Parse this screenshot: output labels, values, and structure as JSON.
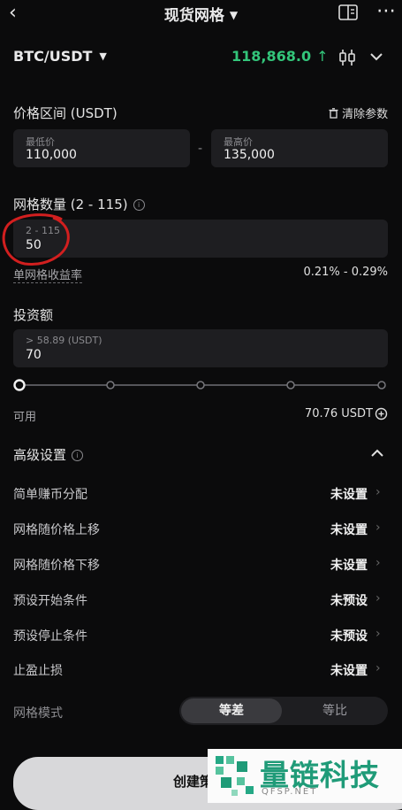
{
  "header": {
    "title": "现货网格",
    "back_icon": "chevron-left-icon",
    "book_icon": "book-icon",
    "more_icon": "more-icon"
  },
  "ticker": {
    "pair": "BTC/USDT",
    "price": "118,868.0",
    "price_color": "#33c57a"
  },
  "price_range": {
    "label": "价格区间 (USDT)",
    "clear_label": "清除参数",
    "low": {
      "placeholder": "最低价",
      "value": "110,000"
    },
    "separator": "-",
    "high": {
      "placeholder": "最高价",
      "value": "135,000"
    }
  },
  "grid_count": {
    "label": "网格数量 (2 - 115)",
    "hint": "2 - 115",
    "value": "50",
    "yield_label": "单网格收益率",
    "yield_value": "0.21% - 0.29%"
  },
  "investment": {
    "label": "投资额",
    "hint": "> 58.89 (USDT)",
    "value": "70",
    "slider_level_percent": 0,
    "available_label": "可用",
    "available_value": "70.76 USDT"
  },
  "advanced": {
    "label": "高级设置",
    "rows": [
      {
        "label": "简单赚币分配",
        "value": "未设置"
      },
      {
        "label": "网格随价格上移",
        "value": "未设置"
      },
      {
        "label": "网格随价格下移",
        "value": "未设置"
      },
      {
        "label": "预设开始条件",
        "value": "未预设"
      },
      {
        "label": "预设停止条件",
        "value": "未预设"
      },
      {
        "label": "止盈止损",
        "value": "未设置"
      }
    ],
    "mode_label": "网格模式",
    "mode_options": [
      "等差",
      "等比"
    ],
    "mode_selected": "等差"
  },
  "footer": {
    "create_label": "创建策"
  },
  "watermark": {
    "text": "量链科技",
    "sub": "QFSP.NET"
  }
}
